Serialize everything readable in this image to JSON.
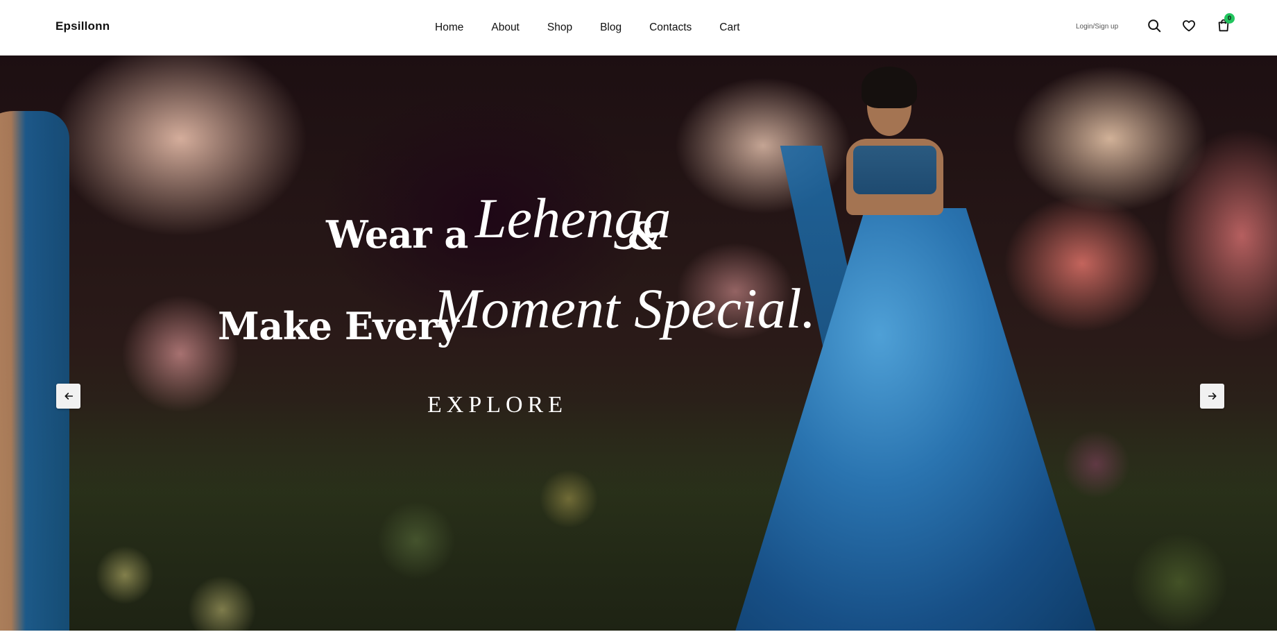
{
  "brand": {
    "name": "Epsillonn"
  },
  "nav": {
    "items": [
      {
        "label": "Home"
      },
      {
        "label": "About"
      },
      {
        "label": "Shop"
      },
      {
        "label": "Blog"
      },
      {
        "label": "Contacts"
      },
      {
        "label": "Cart"
      }
    ]
  },
  "header_actions": {
    "login_label": "Login/Sign up",
    "icons": [
      "search-icon",
      "heart-icon",
      "shopping-bag-icon"
    ],
    "cart_count": "0",
    "badge_color": "#22c55e"
  },
  "hero": {
    "line1_bold": "Wear a",
    "line1_script": "Lehenga",
    "line1_amp": "&",
    "line2_bold": "Make Every",
    "line2_script": "Moment Special.",
    "cta_label": "EXPLORE",
    "prev_icon": "arrow-left-icon",
    "next_icon": "arrow-right-icon"
  }
}
